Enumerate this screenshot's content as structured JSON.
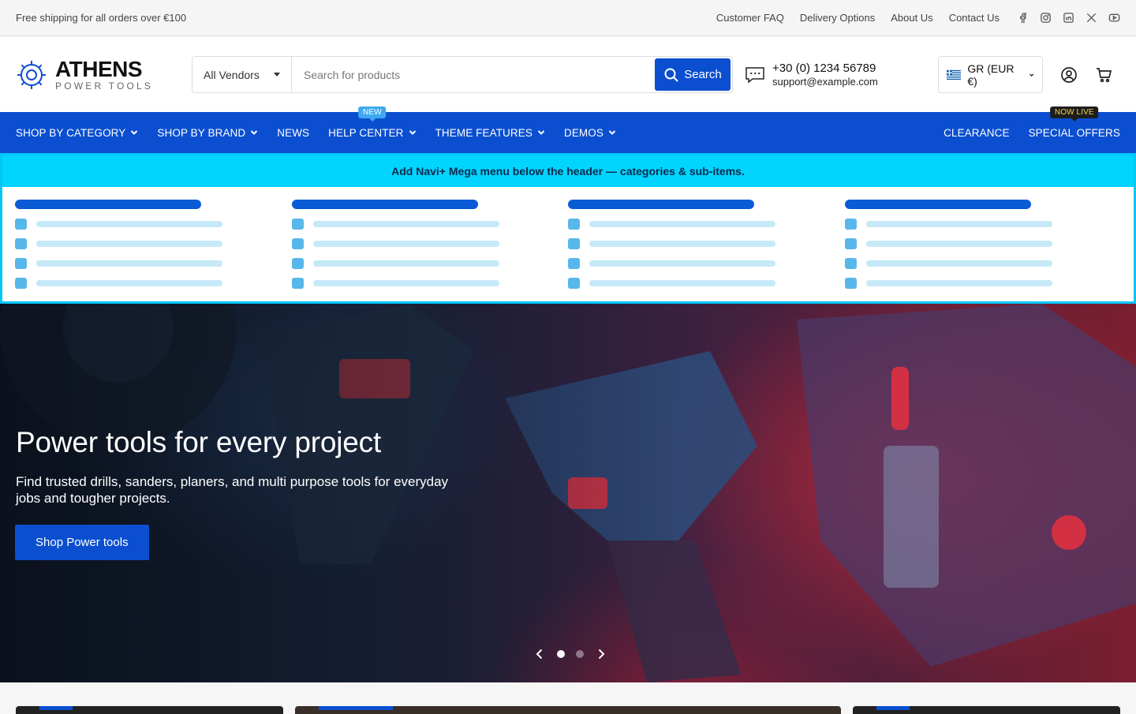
{
  "topbar": {
    "announcement": "Free shipping for all orders over €100",
    "links": [
      "Customer FAQ",
      "Delivery Options",
      "About Us",
      "Contact Us"
    ],
    "socials": [
      "facebook-icon",
      "instagram-icon",
      "linkedin-icon",
      "x-icon",
      "youtube-icon"
    ]
  },
  "header": {
    "logo_title": "ATHENS",
    "logo_subtitle": "POWER TOOLS",
    "vendor_select": "All Vendors",
    "search_placeholder": "Search for products",
    "search_button": "Search",
    "phone": "+30 (0) 1234 56789",
    "email": "support@example.com",
    "currency": "GR (EUR €)"
  },
  "nav": {
    "left": [
      {
        "label": "SHOP BY CATEGORY",
        "dropdown": true
      },
      {
        "label": "SHOP BY BRAND",
        "dropdown": true
      },
      {
        "label": "NEWS",
        "dropdown": false
      },
      {
        "label": "HELP CENTER",
        "dropdown": true,
        "badge": "NEW"
      },
      {
        "label": "THEME FEATURES",
        "dropdown": true
      },
      {
        "label": "DEMOS",
        "dropdown": true
      }
    ],
    "right": [
      {
        "label": "CLEARANCE"
      },
      {
        "label": "SPECIAL OFFERS",
        "badge": "NOW LIVE"
      }
    ]
  },
  "mega_menu": {
    "banner": "Add Navi+ Mega menu below the header — categories & sub-items."
  },
  "hero": {
    "title": "Power tools for every project",
    "subtitle": "Find trusted drills, sanders, planers, and multi purpose tools for everyday jobs and tougher projects.",
    "button": "Shop Power tools",
    "slides_total": 2,
    "active_slide": 1
  },
  "colors": {
    "primary": "#0b4fd0",
    "mega_accent": "#00d4ff",
    "badge_new": "#3fa8f0",
    "badge_live_text": "#f5d34a"
  }
}
